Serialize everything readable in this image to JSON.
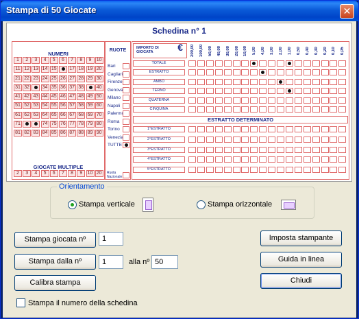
{
  "window": {
    "title": "Stampa di 50 Giocate",
    "close_glyph": "✕"
  },
  "ticket": {
    "title": "Schedina n° 1",
    "numeri_header": "NUMERI",
    "numbers": [
      1,
      2,
      3,
      4,
      5,
      6,
      7,
      8,
      9,
      10,
      11,
      12,
      13,
      14,
      15,
      16,
      17,
      18,
      19,
      20,
      21,
      22,
      23,
      24,
      25,
      26,
      27,
      28,
      29,
      30,
      31,
      32,
      33,
      34,
      35,
      36,
      37,
      38,
      39,
      40,
      41,
      42,
      43,
      44,
      45,
      46,
      47,
      48,
      49,
      50,
      51,
      52,
      53,
      54,
      55,
      56,
      57,
      58,
      59,
      60,
      61,
      62,
      63,
      64,
      65,
      66,
      67,
      68,
      69,
      70,
      71,
      72,
      73,
      74,
      75,
      76,
      77,
      78,
      79,
      80,
      81,
      82,
      83,
      84,
      85,
      86,
      87,
      88,
      89,
      90
    ],
    "marked_numbers": [
      16,
      33,
      39,
      72,
      73
    ],
    "giocate_multiple_header": "GIOCATE MULTIPLE",
    "multiple": [
      "2",
      "3",
      "4",
      "5",
      "6",
      "7",
      "8",
      "9",
      "10",
      "20"
    ],
    "ruote_header": "RUOTE",
    "wheels": [
      "Bari",
      "Cagliari",
      "Firenze",
      "Genova",
      "Milano",
      "Napoli",
      "Palermo",
      "Roma",
      "Torino",
      "Venezia",
      "TUTTE"
    ],
    "marked_wheel": "TUTTE",
    "ruota_nazionale": "Ruota Nazionale",
    "importo_header": "IMPORTO DI GIOCATA",
    "currency_symbol": "€",
    "amounts": [
      "200,00",
      "100,00",
      "50,00",
      "40,00",
      "30,00",
      "20,00",
      "10,00",
      "5,00",
      "4,00",
      "3,00",
      "2,00",
      "1,00",
      "0,50",
      "0,40",
      "0,30",
      "0,20",
      "0,10",
      "0,05"
    ],
    "bet_types": [
      "TOTALE",
      "ESTRATTO",
      "AMBO",
      "TERNO",
      "QUATERNA",
      "CINQUINA"
    ],
    "bet_marks": {
      "TOTALE": [
        "5,00",
        "1,00"
      ],
      "ESTRATTO": [
        "4,00"
      ],
      "AMBO": [
        "2,00"
      ],
      "TERNO": [
        "1,00"
      ],
      "QUATERNA": [],
      "CINQUINA": []
    },
    "estratto_determinato_header": "ESTRATTO DETERMINATO",
    "estratti": [
      "1°ESTRATTO",
      "2°ESTRATTO",
      "3°ESTRATTO",
      "4°ESTRATTO",
      "5°ESTRATTO"
    ]
  },
  "orientation": {
    "label": "Orientamento",
    "vertical_label": "Stampa verticale",
    "horizontal_label": "Stampa orizzontale",
    "selected": "vertical"
  },
  "controls": {
    "stampa_giocata_label": "Stampa giocata nº",
    "stampa_giocata_value": "1",
    "stampa_dalla_label": "Stampa dalla nº",
    "stampa_dalla_value": "1",
    "alla_label": "alla nº",
    "alla_value": "50",
    "calibra_label": "Calibra stampa",
    "checkbox_label": "Stampa il numero della schedina",
    "checkbox_checked": false,
    "imposta_label": "Imposta stampante",
    "guida_label": "Guida in linea",
    "chiudi_label": "Chiudi"
  }
}
